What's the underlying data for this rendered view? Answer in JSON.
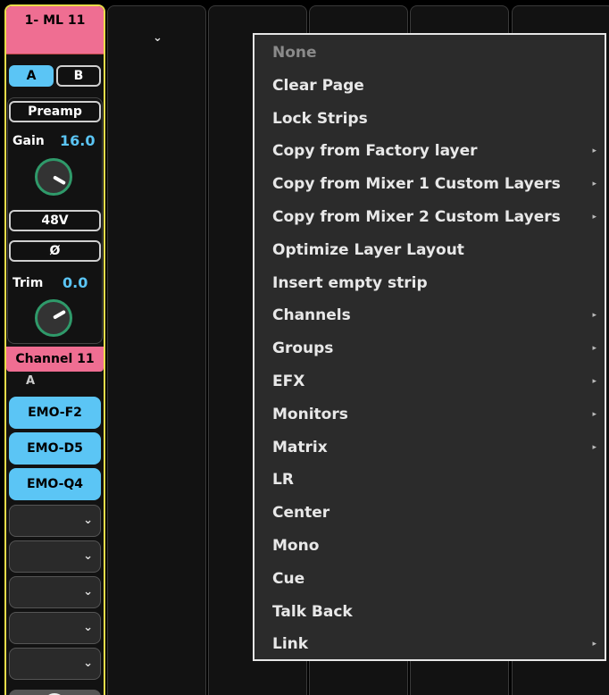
{
  "strip": {
    "title": "1- ML 11",
    "layer_a": "A",
    "layer_b": "B",
    "preamp_label": "Preamp",
    "gain_label": "Gain",
    "gain_value": "16.0",
    "phantom_label": "48V",
    "phase_label": "Ø",
    "trim_label": "Trim",
    "trim_value": "0.0",
    "channel_name": "Channel 11",
    "channel_layer": "A",
    "assignments": [
      "EMO-F2",
      "EMO-D5",
      "EMO-Q4"
    ]
  },
  "icons": {
    "column_dropdown": "chevron-down-icon",
    "dropdown": "chevron-down-icon",
    "submenu": "chevron-right-icon"
  },
  "colors": {
    "strip_title": "#ef6e92",
    "strip_border": "#e9dc4a",
    "accent_blue": "#5bc5f5",
    "knob_ring": "#2f9a6a",
    "menu_bg": "#2b2b2b"
  },
  "menu": {
    "items": [
      {
        "label": "None",
        "disabled": true,
        "submenu": false
      },
      {
        "label": "Clear Page",
        "disabled": false,
        "submenu": false
      },
      {
        "label": "Lock Strips",
        "disabled": false,
        "submenu": false
      },
      {
        "label": "Copy from Factory layer",
        "disabled": false,
        "submenu": true
      },
      {
        "label": "Copy from Mixer 1 Custom Layers",
        "disabled": false,
        "submenu": true
      },
      {
        "label": "Copy from Mixer 2 Custom Layers",
        "disabled": false,
        "submenu": true
      },
      {
        "label": "Optimize Layer Layout",
        "disabled": false,
        "submenu": false
      },
      {
        "label": "Insert empty strip",
        "disabled": false,
        "submenu": false
      },
      {
        "label": "Channels",
        "disabled": false,
        "submenu": true
      },
      {
        "label": "Groups",
        "disabled": false,
        "submenu": true
      },
      {
        "label": "EFX",
        "disabled": false,
        "submenu": true
      },
      {
        "label": "Monitors",
        "disabled": false,
        "submenu": true
      },
      {
        "label": "Matrix",
        "disabled": false,
        "submenu": true
      },
      {
        "label": "LR",
        "disabled": false,
        "submenu": false
      },
      {
        "label": "Center",
        "disabled": false,
        "submenu": false
      },
      {
        "label": "Mono",
        "disabled": false,
        "submenu": false
      },
      {
        "label": "Cue",
        "disabled": false,
        "submenu": false
      },
      {
        "label": "Talk Back",
        "disabled": false,
        "submenu": false
      },
      {
        "label": "Link",
        "disabled": false,
        "submenu": true
      }
    ]
  }
}
